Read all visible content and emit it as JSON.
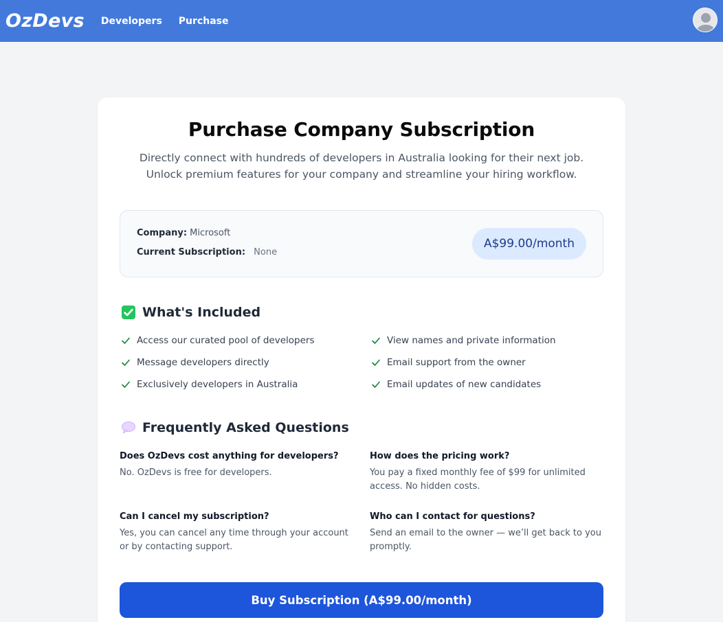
{
  "nav": {
    "brand": "OzDevs",
    "links": [
      "Developers",
      "Purchase"
    ]
  },
  "header": {
    "title": "Purchase Company Subscription",
    "subtitle": "Directly connect with hundreds of developers in Australia looking for their next job. Unlock premium features for your company and streamline your hiring workflow."
  },
  "summary": {
    "company_label": "Company:",
    "company_value": "Microsoft",
    "subscription_label": "Current Subscription:",
    "subscription_value": "None",
    "price": "A$99.00/month"
  },
  "included": {
    "heading": "What's Included",
    "icon": "check-box-emoji",
    "items": [
      "Access our curated pool of developers",
      "View names and private information",
      "Message developers directly",
      "Email support from the owner",
      "Exclusively developers in Australia",
      "Email updates of new candidates"
    ]
  },
  "faq": {
    "heading": "Frequently Asked Questions",
    "icon": "speech-bubble-emoji",
    "items": [
      {
        "q": "Does OzDevs cost anything for developers?",
        "a": "No. OzDevs is free for developers."
      },
      {
        "q": "How does the pricing work?",
        "a": "You pay a fixed monthly fee of $99 for unlimited access. No hidden costs."
      },
      {
        "q": "Can I cancel my subscription?",
        "a": "Yes, you can cancel any time through your account or by contacting support."
      },
      {
        "q": "Who can I contact for questions?",
        "a": "Send an email to the owner — we’ll get back to you promptly."
      }
    ]
  },
  "buy_button": "Buy Subscription (A$99.00/month)",
  "colors": {
    "navbar": "#4279db",
    "button": "#1d55db",
    "price_pill": "#dbeafe",
    "check": "#15803d"
  }
}
